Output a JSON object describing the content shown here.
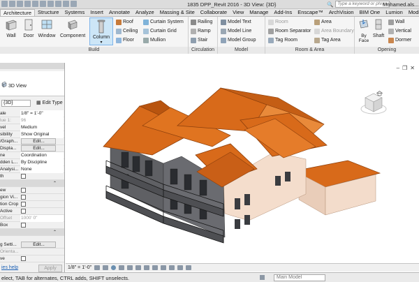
{
  "title_bar": {
    "document_title": "1835 DPP_Revit 2016 - 3D View: {3D}",
    "search_placeholder": "Type a keyword or phrase",
    "user": "Mohamed.als..."
  },
  "tabs": [
    {
      "label": "Architecture",
      "active": true
    },
    {
      "label": "Structure"
    },
    {
      "label": "Systems"
    },
    {
      "label": "Insert"
    },
    {
      "label": "Annotate"
    },
    {
      "label": "Analyze"
    },
    {
      "label": "Massing & Site"
    },
    {
      "label": "Collaborate"
    },
    {
      "label": "View"
    },
    {
      "label": "Manage"
    },
    {
      "label": "Add-Ins"
    },
    {
      "label": "Enscape™"
    },
    {
      "label": "ArchVision"
    },
    {
      "label": "BIM One"
    },
    {
      "label": "Lumion"
    },
    {
      "label": "Modify"
    }
  ],
  "ribbon": {
    "build": {
      "title": "Build",
      "wall": "Wall",
      "door": "Door",
      "window": "Window",
      "component": "Component",
      "column": "Column",
      "roof": "Roof",
      "ceiling": "Ceiling",
      "floor": "Floor",
      "curtain_system": "Curtain System",
      "curtain_grid": "Curtain Grid",
      "mullion": "Mullion"
    },
    "circulation": {
      "title": "Circulation",
      "railing": "Railing",
      "ramp": "Ramp",
      "stair": "Stair"
    },
    "model": {
      "title": "Model",
      "model_text": "Model Text",
      "model_line": "Model Line",
      "model_group": "Model Group"
    },
    "room_area": {
      "title": "Room & Area",
      "room": "Room",
      "room_separator": "Room Separator",
      "tag_room": "Tag Room",
      "area": "Area",
      "area_boundary": "Area Boundary",
      "tag_area": "Tag Area"
    },
    "opening": {
      "title": "Opening",
      "by_face": "By\nFace",
      "shaft": "Shaft",
      "wall": "Wall",
      "vertical": "Vertical",
      "dormer": "Dormer"
    }
  },
  "properties": {
    "type_name": "3D View",
    "filter_value": "{3D}",
    "edit_type": "Edit Type",
    "rows": [
      {
        "k": "ale",
        "v": "1/8\" = 1'-0\""
      },
      {
        "k": "lue  1:",
        "v": "96",
        "dim": true
      },
      {
        "k": "vel",
        "v": "Medium"
      },
      {
        "k": "sibility",
        "v": "Show Original"
      },
      {
        "k": "/Graph...",
        "v": "Edit...",
        "btn": true
      },
      {
        "k": "Displa...",
        "v": "Edit...",
        "btn": true
      },
      {
        "k": "ne",
        "v": "Coordination"
      },
      {
        "k": "dden L...",
        "v": "By Discipline"
      },
      {
        "k": "Analysi...",
        "v": "None"
      },
      {
        "k": "th",
        "cb": true
      },
      {
        "k": "",
        "sec": true
      },
      {
        "k": "ew",
        "cb": true
      },
      {
        "k": "gion Vi...",
        "cb": true
      },
      {
        "k": "tion Crop",
        "cb": true
      },
      {
        "k": "Active",
        "cb": true
      },
      {
        "k": "Offset",
        "v": "1000' 0\"",
        "dim": true
      },
      {
        "k": "Box",
        "cb": true
      },
      {
        "k": "",
        "sec": true
      },
      {
        "k": "g Setti...",
        "v": "Edit...",
        "btn": true
      },
      {
        "k": "Orienta...",
        "dim": true
      },
      {
        "k": "ve",
        "cb": true
      }
    ],
    "help": "ies help",
    "apply": "Apply"
  },
  "viewbar": {
    "scale": "1/8\" = 1'-0\""
  },
  "statusbar": {
    "message": "elect, TAB for alternates, CTRL adds, SHIFT unselects.",
    "workset": "Main Model"
  },
  "colors": {
    "roof": "#d86a1a",
    "roof_dark": "#a9490e",
    "wall_light": "#f3dccb",
    "wall_dark": "#5e5f63",
    "accent": "#2b8fd8"
  }
}
